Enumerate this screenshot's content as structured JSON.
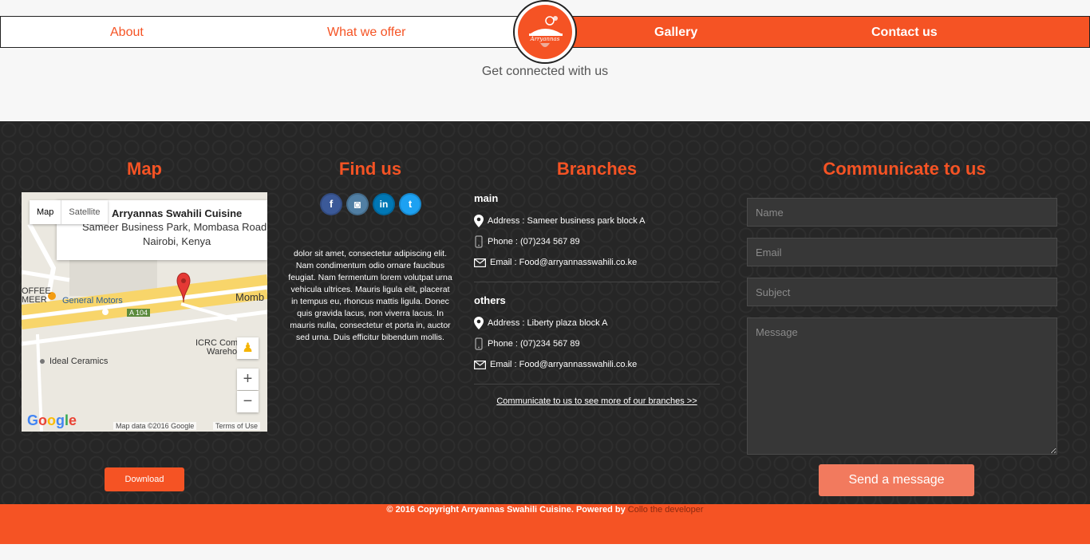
{
  "nav": {
    "about": "About",
    "offer": "What we offer",
    "gallery": "Gallery",
    "contact": "Contact us",
    "logo_text": "Arryannas"
  },
  "subtitle": "Get connected with us",
  "sections": {
    "map": "Map",
    "find": "Find us",
    "branches": "Branches",
    "communicate": "Communicate to us"
  },
  "map": {
    "btn_map": "Map",
    "btn_satellite": "Satellite",
    "place_name": "Arryannas Swahili Cuisine",
    "address_line1": "Sameer Business Park, Mombasa Road",
    "address_line2": "Nairobi, Kenya",
    "label_coffee": "OFFEE",
    "label_meer": "MEER",
    "label_gm": "General Motors",
    "label_a104": "A 104",
    "label_momb": "Momb",
    "label_icrc": "ICRC Comp",
    "label_wareho": "Wareho",
    "label_ideal": "Ideal Ceramics",
    "zoom_in": "+",
    "zoom_out": "−",
    "google": "Google",
    "map_data": "Map data ©2016 Google",
    "terms": "Terms of Use"
  },
  "download": "Download",
  "socials": [
    {
      "name": "facebook",
      "glyph": "f",
      "color": "#3b5998"
    },
    {
      "name": "instagram",
      "glyph": "◙",
      "color": "#517fa4"
    },
    {
      "name": "linkedin",
      "glyph": "in",
      "color": "#0077b5"
    },
    {
      "name": "twitter",
      "glyph": "t",
      "color": "#1da1f2"
    }
  ],
  "find_text": "dolor sit amet, consectetur adipiscing elit. Nam condimentum odio ornare faucibus feugiat. Nam fermentum lorem volutpat urna vehicula ultrices. Mauris ligula elit, placerat in tempus eu, rhoncus mattis ligula. Donec quis gravida lacus, non viverra lacus. In mauris nulla, consectetur et porta in, auctor sed urna. Duis efficitur bibendum mollis.",
  "branches": {
    "main": {
      "title": "main",
      "address": "Address : Sameer business park block A",
      "phone": "Phone : (07)234 567 89",
      "email": "Email : Food@arryannasswahili.co.ke"
    },
    "others": {
      "title": "others",
      "address": "Address : Liberty plaza block A",
      "phone": "Phone : (07)234 567 89",
      "email": "Email : Food@arryannasswahili.co.ke"
    },
    "more_link": "Communicate to us to see more of our branches >>"
  },
  "form": {
    "name_ph": "Name",
    "email_ph": "Email",
    "subject_ph": "Subject",
    "message_ph": "Message",
    "send": "Send a message"
  },
  "copyright": "© 2016 Copyright Arryannas Swahili Cuisine. Powered by ",
  "developer": "Collo the developer",
  "colors": {
    "accent": "#f55324",
    "footer_bg": "#262626"
  }
}
